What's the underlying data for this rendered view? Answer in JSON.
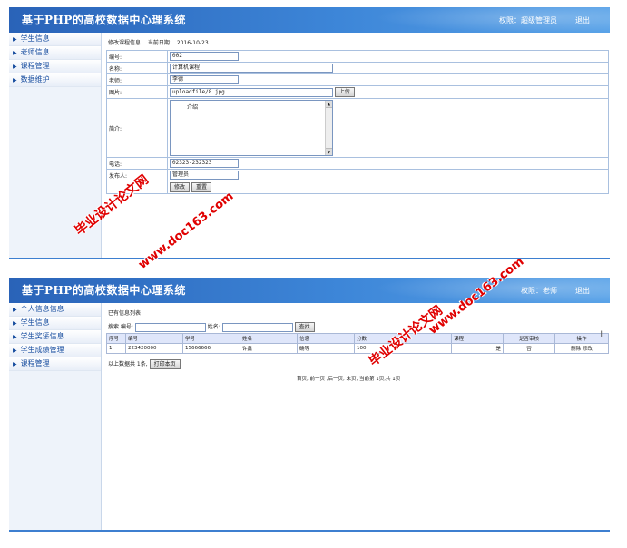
{
  "panel1": {
    "title": "基于PHP的高校数据中心理系统",
    "right_text": "权限：超级管理员",
    "logout": "退出",
    "sidebar": [
      "学生信息",
      "老师信息",
      "课程管理",
      "数据维护"
    ],
    "info_line": "修改课程信息： 当前日期： 2016-10-23",
    "form": {
      "number_label": "编号:",
      "number_value": "002",
      "name_label": "名称:",
      "name_value": "计算机课程",
      "teacher_label": "老师:",
      "teacher_value": "李德",
      "image_label": "图片:",
      "image_value": "uploadfile/8.jpg",
      "upload_button": "上传",
      "intro_label": "简介:",
      "intro_value": "介绍",
      "phone_label": "电话:",
      "phone_value": "02323-232323",
      "publisher_label": "发布人:",
      "publisher_value": "管理员",
      "submit_button": "修改",
      "reset_button": "重置"
    }
  },
  "panel2": {
    "title": "基于PHP的高校数据中心理系统",
    "right_text": "权限：老师",
    "logout": "退出",
    "sidebar": [
      "个人信息信息",
      "学生信息",
      "学生奖惩信息",
      "学生成绩管理",
      "课程管理"
    ],
    "list_caption": "已有信息列表：",
    "search": {
      "prefix": "搜索 编号:",
      "name_label": "姓名:",
      "button": "查找"
    },
    "table": {
      "headers": [
        "序号",
        "编号",
        "学号",
        "姓名",
        "信息",
        "分数",
        "课程",
        "是否审核",
        "操作"
      ],
      "rows": [
        [
          "1",
          "223420000",
          "15666666",
          "许鑫",
          "确等",
          "100",
          "是",
          "否",
          "删除 修改"
        ]
      ]
    },
    "summary": "以上数据共 1条,",
    "print_button": "打印本页",
    "pager": "首页, 前一页 ,后一页, 末页, 当前第 1页,共 1页"
  },
  "watermarks": {
    "brand": "毕业设计论文网",
    "url": "www.doc163.com"
  },
  "colors": {
    "header_start": "#2a63b8",
    "header_end": "#5aa3e8",
    "watermark": "#e00000",
    "table_header": "#dfe6fa"
  }
}
